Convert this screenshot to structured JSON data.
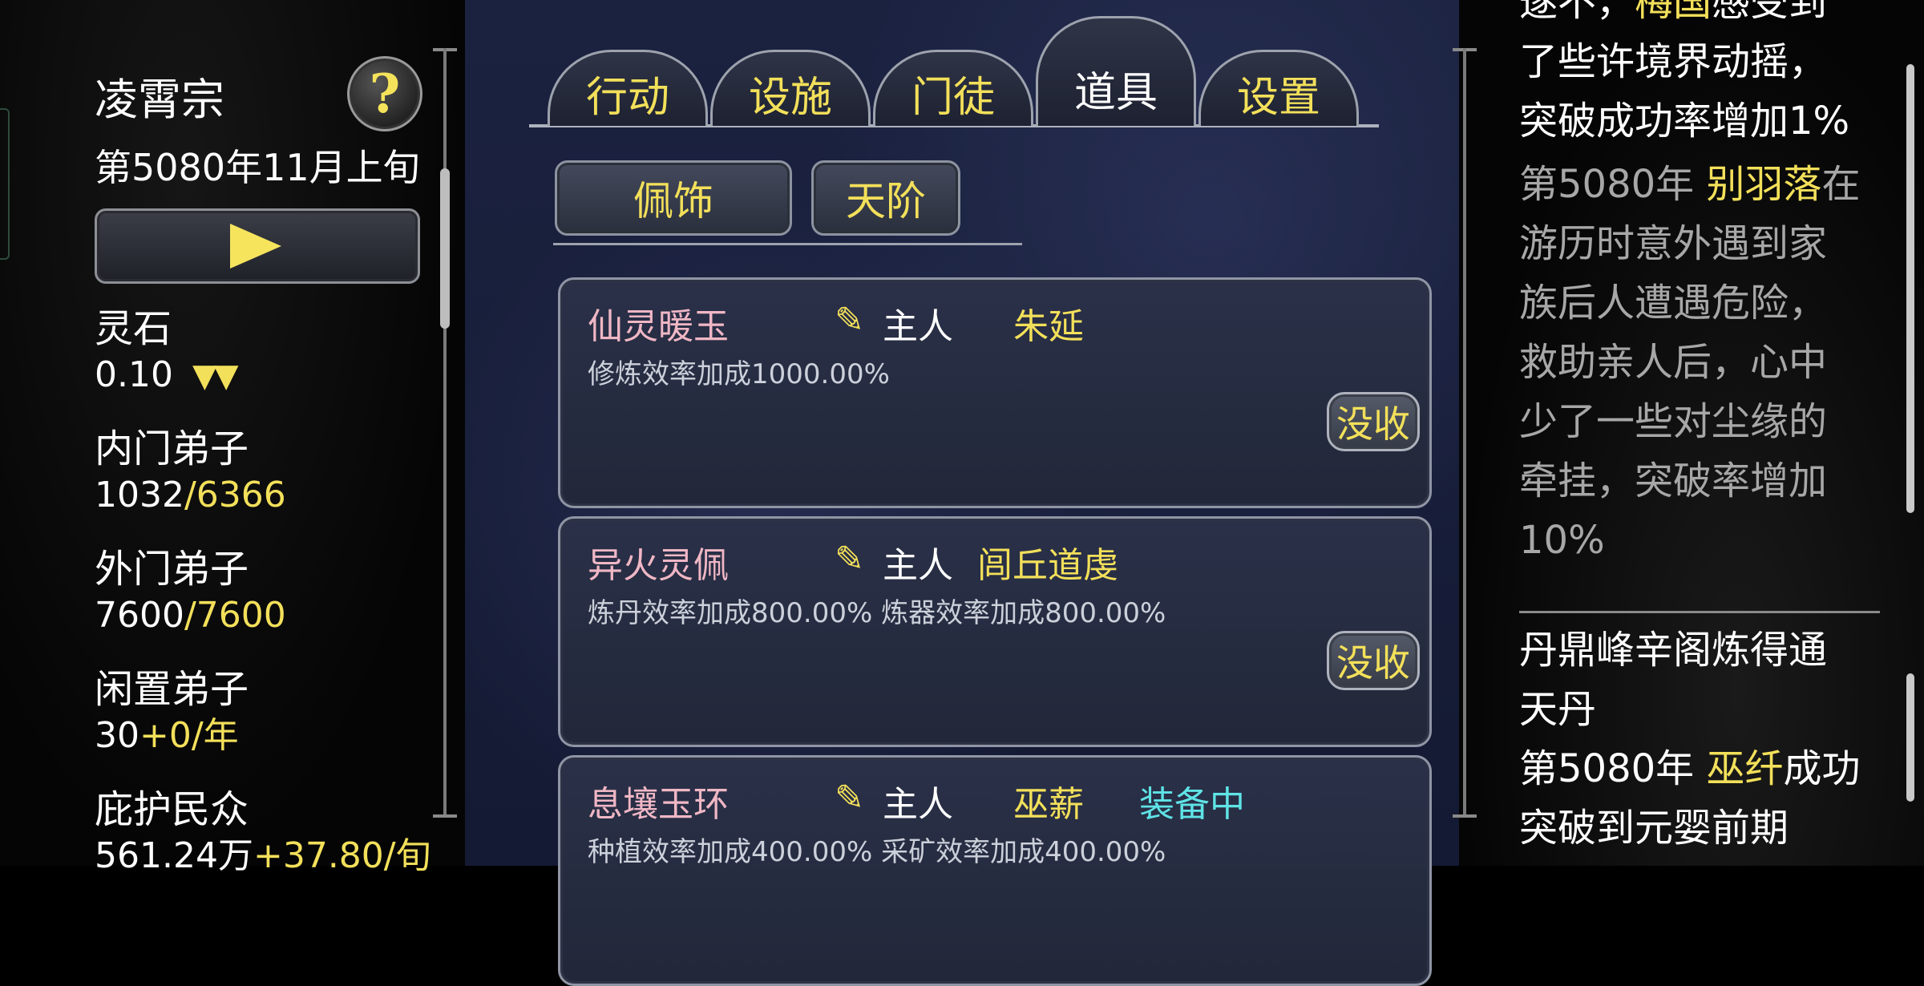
{
  "left": {
    "sect_name": "凌霄宗",
    "help_symbol": "?",
    "date": "第5080年11月上旬",
    "stats": [
      {
        "label": "灵石",
        "value": "0.10",
        "suffix": "",
        "trend": "▼▼"
      },
      {
        "label": "内门弟子",
        "value": "1032",
        "suffix": "/6366",
        "trend": ""
      },
      {
        "label": "外门弟子",
        "value": "7600",
        "suffix": "/7600",
        "trend": ""
      },
      {
        "label": "闲置弟子",
        "value": "30",
        "suffix": "+0/年",
        "trend": ""
      },
      {
        "label": "庇护民众",
        "value": "561.24万",
        "suffix": "+37.80/旬",
        "trend": ""
      }
    ]
  },
  "tabs": [
    "行动",
    "设施",
    "门徒",
    "道具",
    "设置"
  ],
  "active_tab": "道具",
  "subtabs": [
    "佩饰",
    "天阶"
  ],
  "owner_label": "主人",
  "confiscate_label": "没收",
  "items": [
    {
      "name": "仙灵暖玉",
      "owner": "朱延",
      "status": "",
      "desc": "修炼效率加成1000.00%"
    },
    {
      "name": "异火灵佩",
      "owner": "闾丘道虔",
      "status": "",
      "desc": "炼丹效率加成800.00% 炼器效率加成800.00%"
    },
    {
      "name": "息壤玉环",
      "owner": "巫薪",
      "status": "装备中",
      "desc": "种植效率加成400.00% 采矿效率加成400.00%"
    }
  ],
  "log": {
    "l0_a": "遂不，",
    "l0_b": "梅国",
    "l0_c": "感受到",
    "l1": "了些许境界动摇，",
    "l2": "突破成功率增加1%",
    "e2_year": "第5080年 ",
    "e2_name": "别羽落",
    "e2_rest1": "在",
    "e2_l2": "游历时意外遇到家",
    "e2_l3": "族后人遭遇危险，",
    "e2_l4": "救助亲人后，心中",
    "e2_l5": "少了一些对尘缘的",
    "e2_l6": "牵挂，突破率增加",
    "e2_l7": "10%",
    "e3_l1": "丹鼎峰辛阁炼得通",
    "e3_l2": "天丹",
    "e4_year": "第5080年 ",
    "e4_name": "巫纤",
    "e4_rest": "成功",
    "e4_l2": "突破到元婴前期"
  },
  "colors": {
    "accent_yellow": "#f3e05a",
    "item_pink": "#f0b7c5",
    "equipped_cyan": "#5fe3e6"
  }
}
